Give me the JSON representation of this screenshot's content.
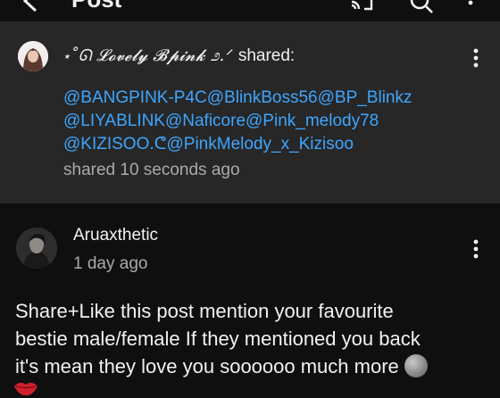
{
  "header": {
    "title": "Post"
  },
  "shared_card": {
    "sharer_name": "⋆˚ᘏ 𝓛𝓸𝓿𝓮𝓵𝔂 𝓑𝓹𝓲𝓷𝓴 ೨.ᐟ",
    "shared_label": "shared:",
    "mentions": [
      "@BANGPINK-P4C@BlinkBoss56@BP_Blinkz",
      "@LIYABLINK@Naficore@Pink_melody78",
      "@KIZISOO.ᕦ@PinkMelody_x_Kizisoo"
    ],
    "time": "shared 10 seconds ago"
  },
  "post": {
    "author": "Aruaxthetic",
    "time": "1 day ago",
    "text_lines": [
      "Share+Like this post mention your favourite",
      "bestie male/female If they mentioned you back",
      "it's mean they love you soooooo much more"
    ]
  },
  "colors": {
    "background": "#0f0f0f",
    "card": "#272727",
    "mention": "#3ea6ff",
    "secondary_text": "#aaaaaa"
  },
  "icons": [
    "back-arrow-icon",
    "cast-icon",
    "search-icon",
    "more-vert-icon",
    "moon-emoji-icon",
    "lips-emoji-icon"
  ]
}
